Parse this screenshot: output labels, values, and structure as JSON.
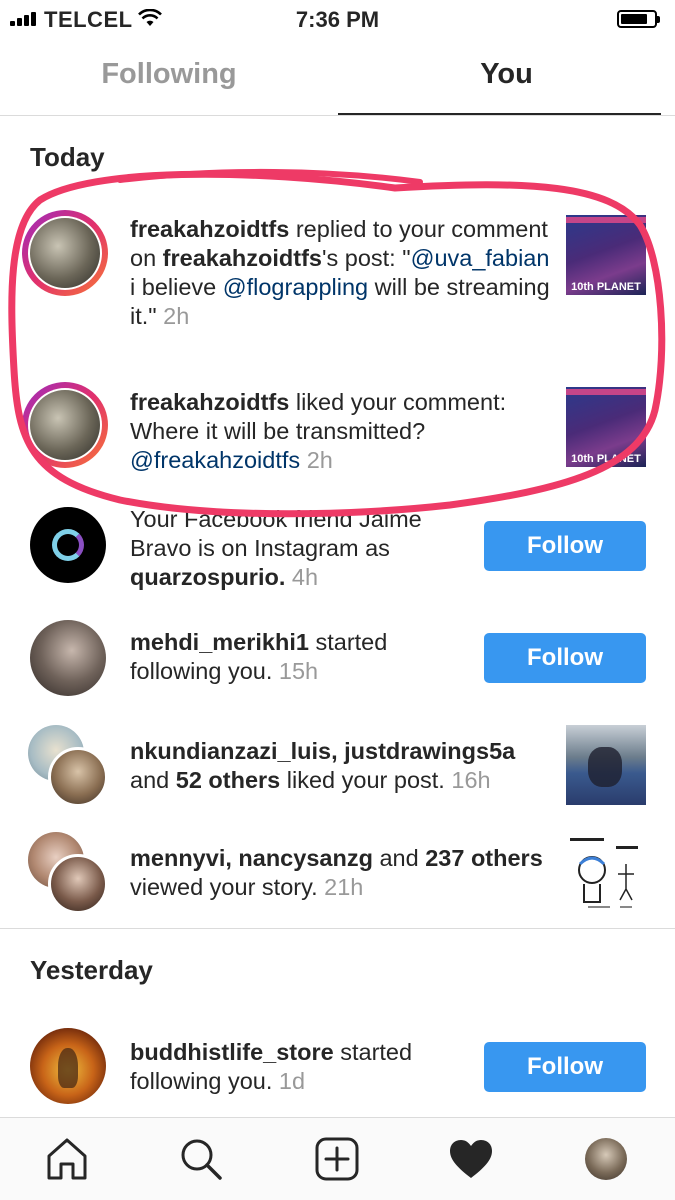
{
  "status_bar": {
    "carrier": "TELCEL",
    "time": "7:36 PM",
    "signal_icon": "signal-bars-icon",
    "wifi_icon": "wifi-icon",
    "battery_icon": "battery-icon"
  },
  "tabs": [
    {
      "label": "Following",
      "active": false
    },
    {
      "label": "You",
      "active": true
    }
  ],
  "sections": {
    "today": "Today",
    "yesterday": "Yesterday"
  },
  "notifications": {
    "n1": {
      "user": "freakahzoidtfs",
      "text_a": " replied to your comment on ",
      "user2": "freakahzoidtfs",
      "text_b": "'s post: \"",
      "mention1": "@uva_fabian",
      "text_c": " i believe ",
      "mention2": "@flograppling",
      "text_d": " will be streaming it.\"",
      "time": "2h",
      "thumb_caption": "10th PLANET"
    },
    "n2": {
      "user": "freakahzoidtfs",
      "text_a": " liked your comment: Where it will be transmitted? ",
      "mention": "@freakahzoidtfs",
      "time": "2h",
      "thumb_caption": "10th PLANET"
    },
    "n3": {
      "text_a": "Your Facebook friend Jaime Bravo is on Instagram as ",
      "user": "quarzospurio.",
      "time": "4h",
      "button": "Follow"
    },
    "n4": {
      "user": "mehdi_merikhi1",
      "text_a": " started following you.",
      "time": "15h",
      "button": "Follow"
    },
    "n5": {
      "user": "nkundianzazi_luis, justdrawings5a",
      "text_a": " and ",
      "count": "52 others",
      "text_b": " liked your post.",
      "time": "16h"
    },
    "n6": {
      "user": "mennyvi, nancysanzg",
      "text_a": " and ",
      "count": "237 others",
      "text_b": " viewed your story.",
      "time": "21h"
    },
    "n7": {
      "user": "buddhistlife_store",
      "text_a": " started following you.",
      "time": "1d",
      "button": "Follow"
    }
  },
  "bottom_nav": [
    "home-icon",
    "search-icon",
    "new-post-icon",
    "activity-heart-icon",
    "profile-avatar"
  ],
  "colors": {
    "follow_blue": "#3897f0",
    "mention": "#003569",
    "highlight_marker": "#ee3a66"
  }
}
